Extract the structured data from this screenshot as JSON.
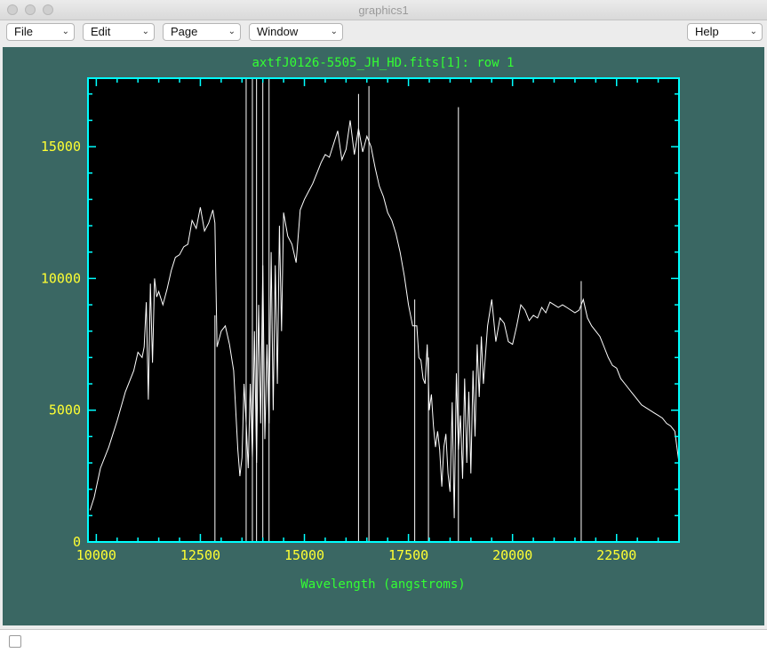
{
  "window": {
    "title": "graphics1"
  },
  "menus": [
    {
      "label": "File"
    },
    {
      "label": "Edit"
    },
    {
      "label": "Page"
    },
    {
      "label": "Window"
    },
    {
      "label": "Help"
    }
  ],
  "colors": {
    "background": "#3a6763",
    "frame": "#00ffff",
    "tick_labels": "#ffff33",
    "titles": "#33ff33",
    "trace": "#ffffff",
    "plot_bg": "#000000"
  },
  "chart_data": {
    "type": "line",
    "title": "axtfJ0126-5505_JH_HD.fits[1]: row 1",
    "xlabel": "Wavelength (angstroms)",
    "ylabel": "",
    "xlim": [
      9800,
      24000
    ],
    "ylim": [
      0,
      17600
    ],
    "x_ticks": [
      10000,
      12500,
      15000,
      17500,
      20000,
      22500
    ],
    "y_ticks": [
      0,
      5000,
      10000,
      15000
    ],
    "grid": false,
    "series": [
      {
        "x": [
          9850,
          9950,
          10100,
          10300,
          10500,
          10700,
          10900,
          11000,
          11100,
          11150,
          11200,
          11250,
          11300,
          11350,
          11400,
          11450,
          11500,
          11600,
          11700,
          11800,
          11900,
          12000,
          12100,
          12200,
          12300,
          12400,
          12500,
          12600,
          12700,
          12800,
          12850,
          12900,
          13000,
          13100,
          13200,
          13300,
          13400,
          13450,
          13500,
          13550,
          13600,
          13650,
          13700,
          13750,
          13800,
          13850,
          13900,
          13950,
          14000,
          14050,
          14100,
          14150,
          14200,
          14250,
          14300,
          14350,
          14400,
          14450,
          14500,
          14600,
          14700,
          14800,
          14900,
          15000,
          15100,
          15200,
          15300,
          15400,
          15500,
          15600,
          15700,
          15800,
          15900,
          16000,
          16100,
          16200,
          16300,
          16400,
          16500,
          16600,
          16700,
          16800,
          16900,
          17000,
          17100,
          17200,
          17300,
          17400,
          17500,
          17600,
          17700,
          17750,
          17800,
          17850,
          17900,
          17950,
          18000,
          18050,
          18100,
          18150,
          18200,
          18250,
          18300,
          18350,
          18400,
          18450,
          18500,
          18550,
          18600,
          18650,
          18700,
          18750,
          18800,
          18850,
          18900,
          18950,
          19000,
          19050,
          19100,
          19150,
          19200,
          19250,
          19300,
          19400,
          19500,
          19600,
          19700,
          19800,
          19900,
          20000,
          20100,
          20200,
          20300,
          20400,
          20500,
          20600,
          20700,
          20800,
          20900,
          21000,
          21100,
          21200,
          21300,
          21400,
          21500,
          21600,
          21700,
          21800,
          21900,
          22000,
          22100,
          22200,
          22300,
          22400,
          22500,
          22600,
          22700,
          22800,
          22900,
          23000,
          23100,
          23200,
          23300,
          23400,
          23500,
          23600,
          23700,
          23800,
          23900,
          24000
        ],
        "y": [
          1200,
          1700,
          2800,
          3600,
          4600,
          5700,
          6500,
          7200,
          7000,
          7400,
          9100,
          5400,
          9800,
          6800,
          10000,
          9300,
          9500,
          9000,
          9600,
          10300,
          10800,
          10900,
          11200,
          11300,
          12200,
          11900,
          12700,
          11800,
          12100,
          12600,
          12100,
          7400,
          8000,
          8200,
          7500,
          6500,
          3500,
          2500,
          3200,
          6000,
          4500,
          2800,
          6000,
          3200,
          8000,
          3000,
          9000,
          4500,
          10500,
          3900,
          7500,
          4500,
          11000,
          5000,
          10500,
          6000,
          12000,
          8000,
          12500,
          11600,
          11300,
          10600,
          12600,
          13000,
          13300,
          13600,
          14000,
          14400,
          14700,
          14600,
          15100,
          15600,
          14500,
          14900,
          16000,
          14700,
          15700,
          14800,
          15400,
          15000,
          14200,
          13500,
          13100,
          12500,
          12200,
          11700,
          11000,
          10100,
          9000,
          8200,
          8200,
          7000,
          6900,
          6200,
          6000,
          7500,
          5000,
          5600,
          4400,
          3600,
          4200,
          3500,
          2100,
          3600,
          4100,
          2600,
          1900,
          5300,
          900,
          6400,
          3500,
          4800,
          2400,
          6200,
          3000,
          5700,
          2600,
          6500,
          4000,
          7500,
          5500,
          7800,
          6000,
          8200,
          9200,
          7600,
          8500,
          8300,
          7600,
          7500,
          8200,
          9000,
          8800,
          8400,
          8600,
          8500,
          8900,
          8700,
          9100,
          9000,
          8900,
          9000,
          8900,
          8800,
          8700,
          8800,
          9200,
          8500,
          8200,
          8000,
          7800,
          7400,
          7000,
          6700,
          6600,
          6200,
          6000,
          5800,
          5600,
          5400,
          5200,
          5100,
          5000,
          4900,
          4800,
          4700,
          4500,
          4400,
          4200,
          3000
        ]
      }
    ],
    "spikes": [
      {
        "x": 12850,
        "y": 8600
      },
      {
        "x": 13600,
        "y": 17600
      },
      {
        "x": 13750,
        "y": 17600
      },
      {
        "x": 13850,
        "y": 17600
      },
      {
        "x": 14000,
        "y": 17600
      },
      {
        "x": 14150,
        "y": 17600
      },
      {
        "x": 16300,
        "y": 17000
      },
      {
        "x": 16550,
        "y": 17300
      },
      {
        "x": 17650,
        "y": 9200
      },
      {
        "x": 17980,
        "y": 7000
      },
      {
        "x": 18700,
        "y": 16500
      },
      {
        "x": 21650,
        "y": 9900
      }
    ]
  }
}
